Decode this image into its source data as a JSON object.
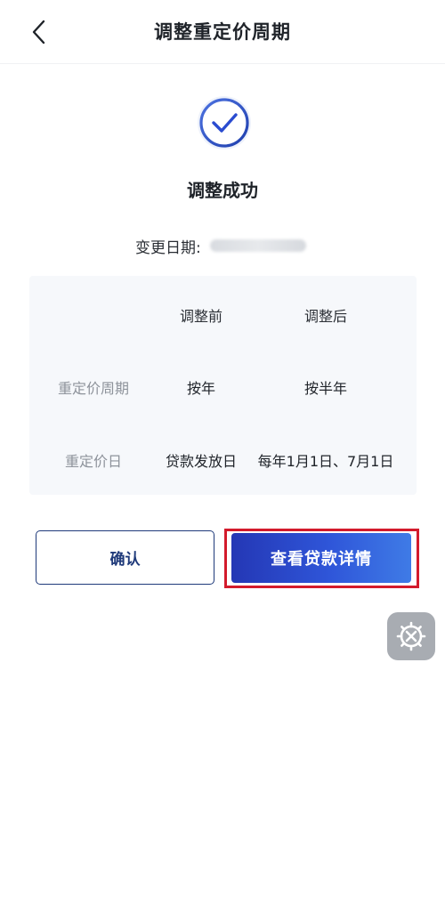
{
  "nav": {
    "title": "调整重定价周期",
    "back_icon": "chevron-left-icon"
  },
  "result": {
    "icon": "check-circle-icon",
    "title": "调整成功",
    "date_label": "变更日期:",
    "date_value_obscured": true
  },
  "table": {
    "headers": [
      "调整前",
      "调整后"
    ],
    "rows": [
      {
        "label": "重定价周期",
        "before": "按年",
        "after": "按半年"
      },
      {
        "label": "重定价日",
        "before": "贷款发放日",
        "after": "每年1月1日、7月1日"
      }
    ]
  },
  "buttons": {
    "confirm_label": "确认",
    "detail_label": "查看贷款详情"
  },
  "floating_tool": {
    "icon": "gear-wrench-icon"
  },
  "colors": {
    "primary_blue": "#2a4bd0",
    "confirm_border": "#1f3a7a",
    "highlight_red": "#d31b2c",
    "table_bg": "#f6f8fb",
    "muted_text": "#8e939b"
  }
}
